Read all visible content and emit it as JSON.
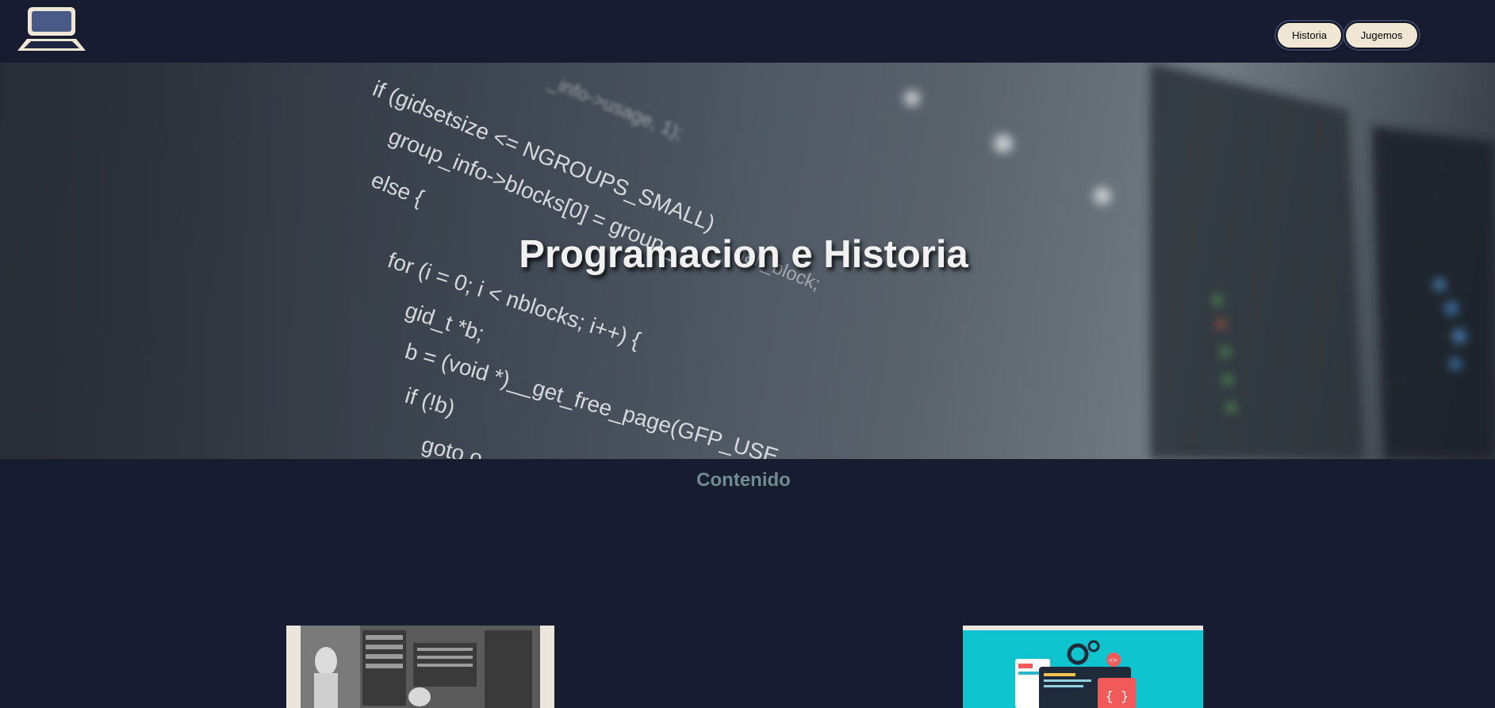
{
  "header": {
    "logo_icon": "laptop-icon",
    "nav": [
      {
        "label": "Historia"
      },
      {
        "label": "Jugemos"
      }
    ]
  },
  "hero": {
    "title": "Programacion e Historia",
    "code_lines": [
      "_info->usage, 1);",
      "if (gidsetsize <= NGROUPS_SMALL)",
      "group_info->blocks[0] = group_",
      "else {",
      "nall_block;",
      "for (i = 0; i < nblocks; i++) {",
      "gid_t *b;",
      "b = (void *)__get_free_page(GFP_USE",
      "if (!b)",
      "goto o"
    ]
  },
  "content": {
    "title": "Contenido",
    "cards": [
      {
        "image": "vintage-computer-photo"
      },
      {
        "image": "programming-illustration"
      }
    ]
  },
  "colors": {
    "background": "#171c31",
    "button": "#efe7d4",
    "section_title": "#6f8c8f",
    "hero_title": "#f1f1f1",
    "illustration_bg": "#0fc3cf"
  }
}
